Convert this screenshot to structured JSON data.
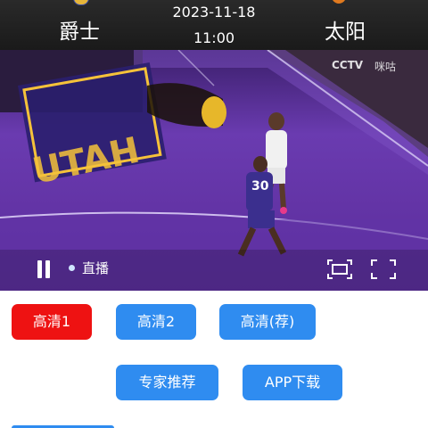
{
  "header": {
    "home_team": "爵士",
    "away_team": "太阳",
    "date": "2023-11-18",
    "time": "11:00"
  },
  "video": {
    "channel_logo": "CCTV",
    "channel_logo_2": "咪咕",
    "live_label": "直播",
    "player_number": "30",
    "court_text": "UTAH"
  },
  "buttons": {
    "hd1": "高清1",
    "hd2": "高清2",
    "hd_recommended": "高清(荐)",
    "expert": "专家推荐",
    "app_download": "APP下载"
  },
  "colors": {
    "active_button": "#ee1212",
    "button": "#2f8cf0",
    "court": "#5d2f9c"
  }
}
